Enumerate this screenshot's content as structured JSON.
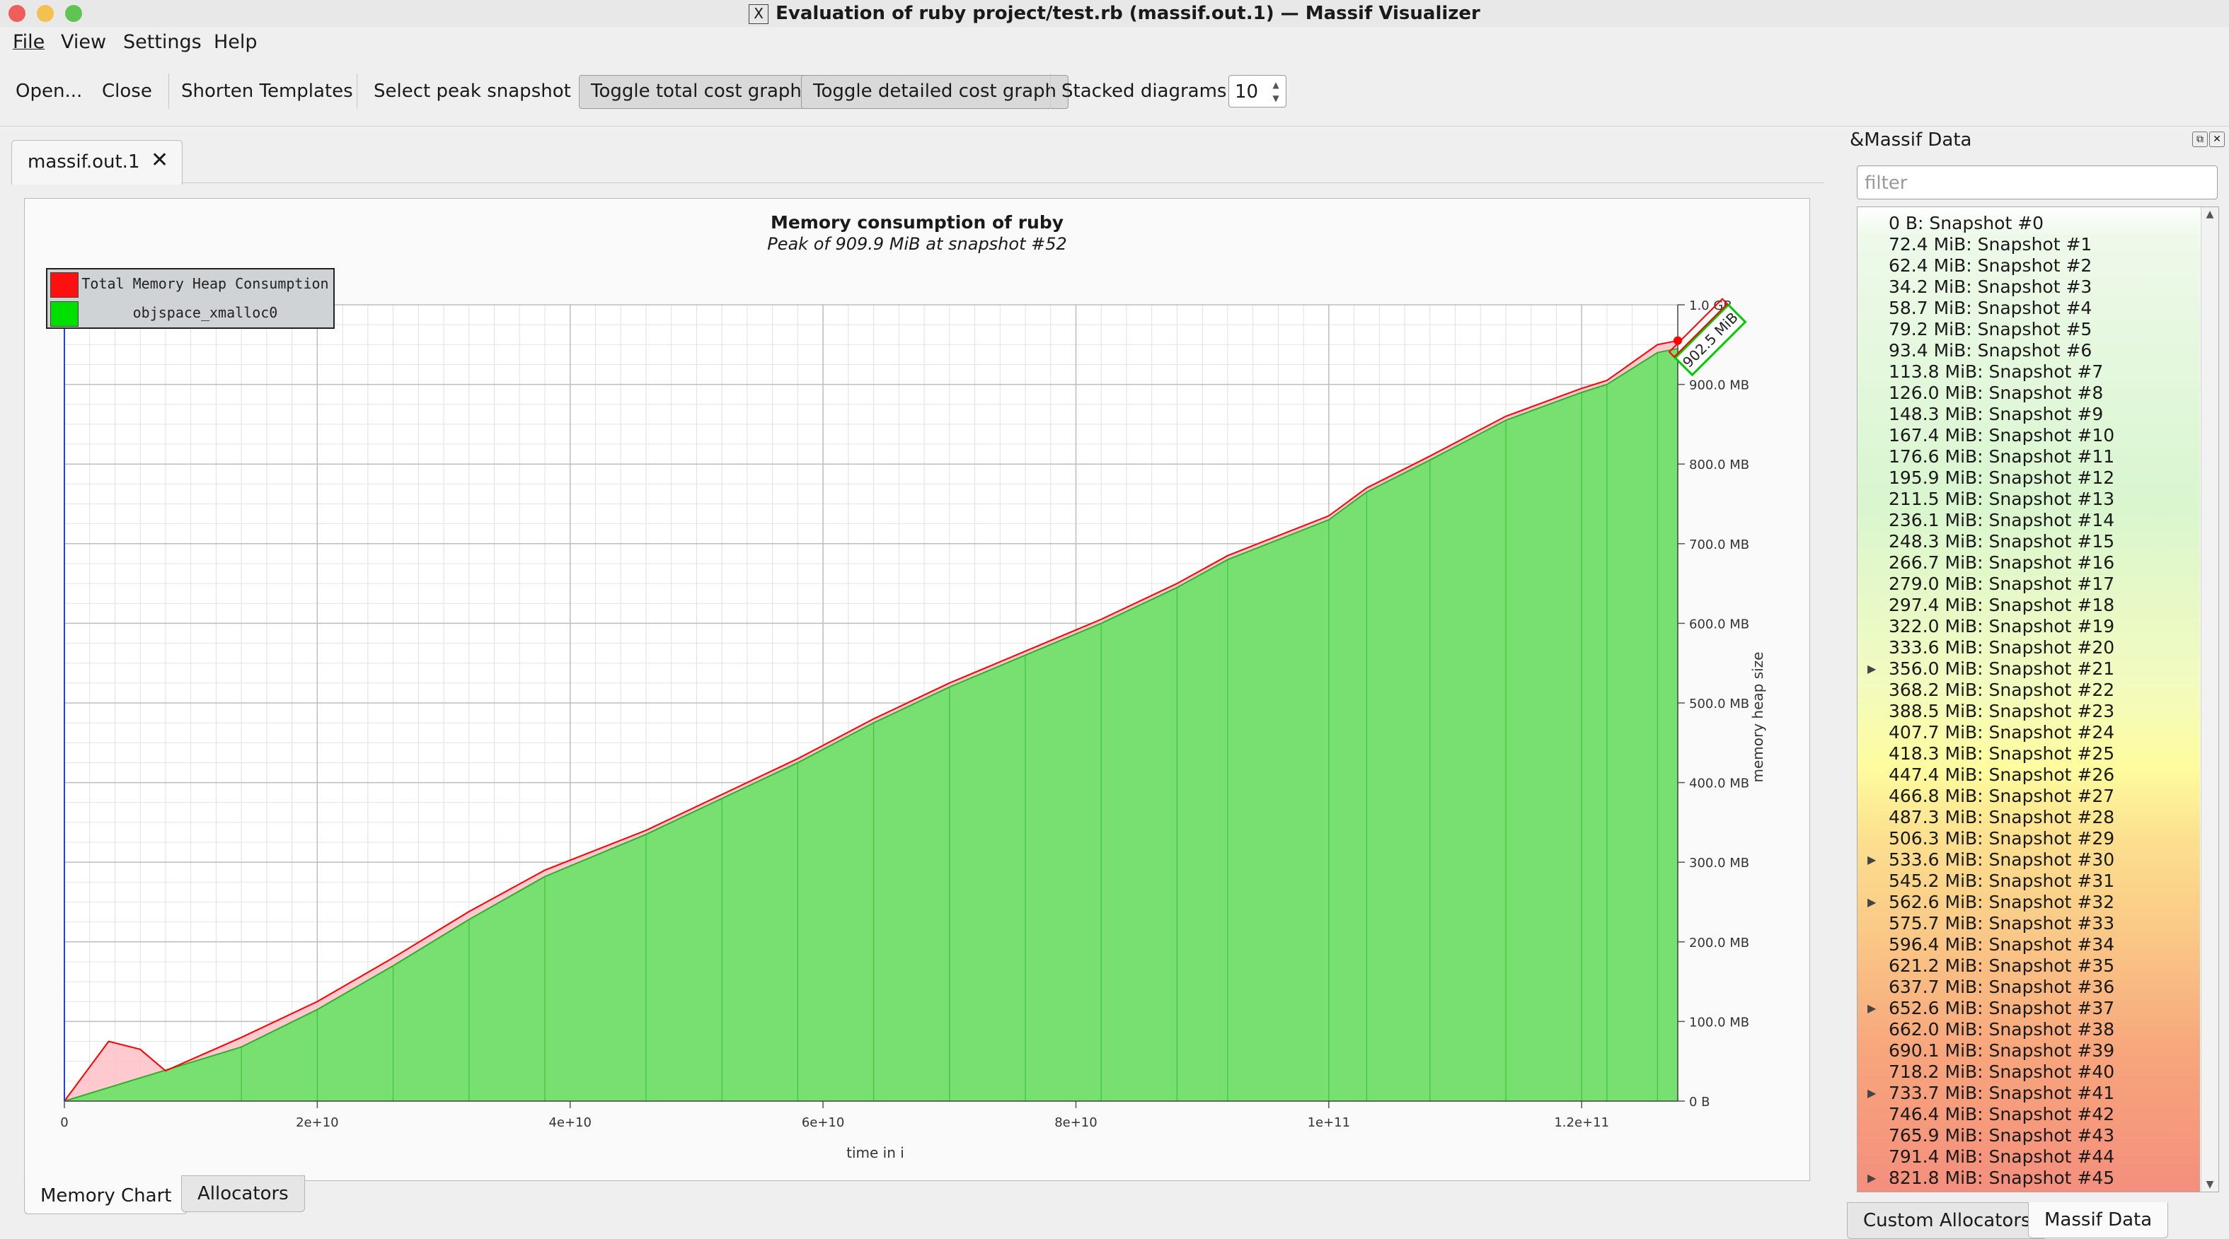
{
  "window": {
    "title": "Evaluation of ruby project/test.rb (massif.out.1) — Massif Visualizer",
    "x11_glyph": "X",
    "traffic_light_colors": [
      "#ee5f5b",
      "#f4c04f",
      "#5fc453"
    ]
  },
  "menu": [
    "File",
    "View",
    "Settings",
    "Help"
  ],
  "toolbar": {
    "open": "Open...",
    "close": "Close",
    "shorten_templates": "Shorten Templates",
    "select_peak": "Select peak snapshot",
    "toggle_total": "Toggle total cost graph",
    "toggle_detailed": "Toggle detailed cost graph",
    "stacked_label": "Stacked diagrams:",
    "stacked_value": "10"
  },
  "document_tab": {
    "label": "massif.out.1",
    "close_icon": "close-icon"
  },
  "chart_data": {
    "type": "area",
    "title": "Memory consumption of ruby",
    "subtitle": "Peak of 909.9 MiB at snapshot #52",
    "xlabel": "time in i",
    "ylabel": "memory heap size",
    "x_ticks": [
      "0",
      "2e+10",
      "4e+10",
      "6e+10",
      "8e+10",
      "1e+11",
      "1.2e+11"
    ],
    "x_tick_values": [
      0,
      20000000000,
      40000000000,
      60000000000,
      80000000000,
      100000000000,
      120000000000
    ],
    "y_ticks": [
      "0 B",
      "100.0 MB",
      "200.0 MB",
      "300.0 MB",
      "400.0 MB",
      "500.0 MB",
      "600.0 MB",
      "700.0 MB",
      "800.0 MB",
      "900.0 MB",
      "1.0 GB"
    ],
    "y_tick_values_mb": [
      0,
      100,
      200,
      300,
      400,
      500,
      600,
      700,
      800,
      900,
      1000
    ],
    "xlim": [
      0,
      127600000000
    ],
    "ylim_mb": [
      0,
      1000
    ],
    "grid": true,
    "legend_position": "top-left",
    "peak_label": "902.5 MiB",
    "series": [
      {
        "name": "Total Memory Heap Consumption",
        "color": "#ff0000",
        "fill": "#ffc0c8",
        "x": [
          0,
          3500000000.0,
          6000000000.0,
          8000000000.0,
          14000000000.0,
          20000000000.0,
          26000000000.0,
          32000000000.0,
          38000000000.0,
          46000000000.0,
          52000000000.0,
          58000000000.0,
          64000000000.0,
          70000000000.0,
          76000000000.0,
          82000000000.0,
          88000000000.0,
          92000000000.0,
          100000000000.0,
          103000000000.0,
          108000000000.0,
          114000000000.0,
          120000000000.0,
          122000000000.0,
          126000000000.0,
          127600000000.0
        ],
        "y": [
          0,
          75,
          65,
          38,
          80,
          125,
          180,
          238,
          290,
          340,
          385,
          430,
          480,
          525,
          565,
          605,
          650,
          685,
          735,
          770,
          810,
          860,
          895,
          905,
          950,
          955
        ]
      },
      {
        "name": "objspace_xmalloc0",
        "color": "#00dd00",
        "fill": "#78e070",
        "x": [
          0,
          14000000000.0,
          20000000000.0,
          26000000000.0,
          32000000000.0,
          38000000000.0,
          46000000000.0,
          52000000000.0,
          58000000000.0,
          64000000000.0,
          70000000000.0,
          76000000000.0,
          82000000000.0,
          88000000000.0,
          92000000000.0,
          100000000000.0,
          103000000000.0,
          108000000000.0,
          114000000000.0,
          120000000000.0,
          122000000000.0,
          126000000000.0,
          127600000000.0
        ],
        "y": [
          0,
          68,
          115,
          170,
          228,
          282,
          335,
          380,
          425,
          475,
          520,
          560,
          600,
          645,
          680,
          730,
          765,
          805,
          855,
          890,
          900,
          940,
          945
        ]
      }
    ]
  },
  "bottom_tabs": [
    "Memory Chart",
    "Allocators"
  ],
  "dock": {
    "title": "&Massif Data",
    "filter_placeholder": "filter",
    "snapshots": [
      "0 B: Snapshot #0",
      "72.4 MiB: Snapshot #1",
      "62.4 MiB: Snapshot #2",
      "34.2 MiB: Snapshot #3",
      "58.7 MiB: Snapshot #4",
      "79.2 MiB: Snapshot #5",
      "93.4 MiB: Snapshot #6",
      "113.8 MiB: Snapshot #7",
      "126.0 MiB: Snapshot #8",
      "148.3 MiB: Snapshot #9",
      "167.4 MiB: Snapshot #10",
      "176.6 MiB: Snapshot #11",
      "195.9 MiB: Snapshot #12",
      "211.5 MiB: Snapshot #13",
      "236.1 MiB: Snapshot #14",
      "248.3 MiB: Snapshot #15",
      "266.7 MiB: Snapshot #16",
      "279.0 MiB: Snapshot #17",
      "297.4 MiB: Snapshot #18",
      "322.0 MiB: Snapshot #19",
      "333.6 MiB: Snapshot #20",
      "356.0 MiB: Snapshot #21",
      "368.2 MiB: Snapshot #22",
      "388.5 MiB: Snapshot #23",
      "407.7 MiB: Snapshot #24",
      "418.3 MiB: Snapshot #25",
      "447.4 MiB: Snapshot #26",
      "466.8 MiB: Snapshot #27",
      "487.3 MiB: Snapshot #28",
      "506.3 MiB: Snapshot #29",
      "533.6 MiB: Snapshot #30",
      "545.2 MiB: Snapshot #31",
      "562.6 MiB: Snapshot #32",
      "575.7 MiB: Snapshot #33",
      "596.4 MiB: Snapshot #34",
      "621.2 MiB: Snapshot #35",
      "637.7 MiB: Snapshot #36",
      "652.6 MiB: Snapshot #37",
      "662.0 MiB: Snapshot #38",
      "690.1 MiB: Snapshot #39",
      "718.2 MiB: Snapshot #40",
      "733.7 MiB: Snapshot #41",
      "746.4 MiB: Snapshot #42",
      "765.9 MiB: Snapshot #43",
      "791.4 MiB: Snapshot #44",
      "821.8 MiB: Snapshot #45"
    ],
    "expandable_rows": [
      21,
      30,
      32,
      37,
      41,
      45
    ]
  },
  "dock_tabs": [
    "Custom Allocators",
    "Massif Data"
  ]
}
